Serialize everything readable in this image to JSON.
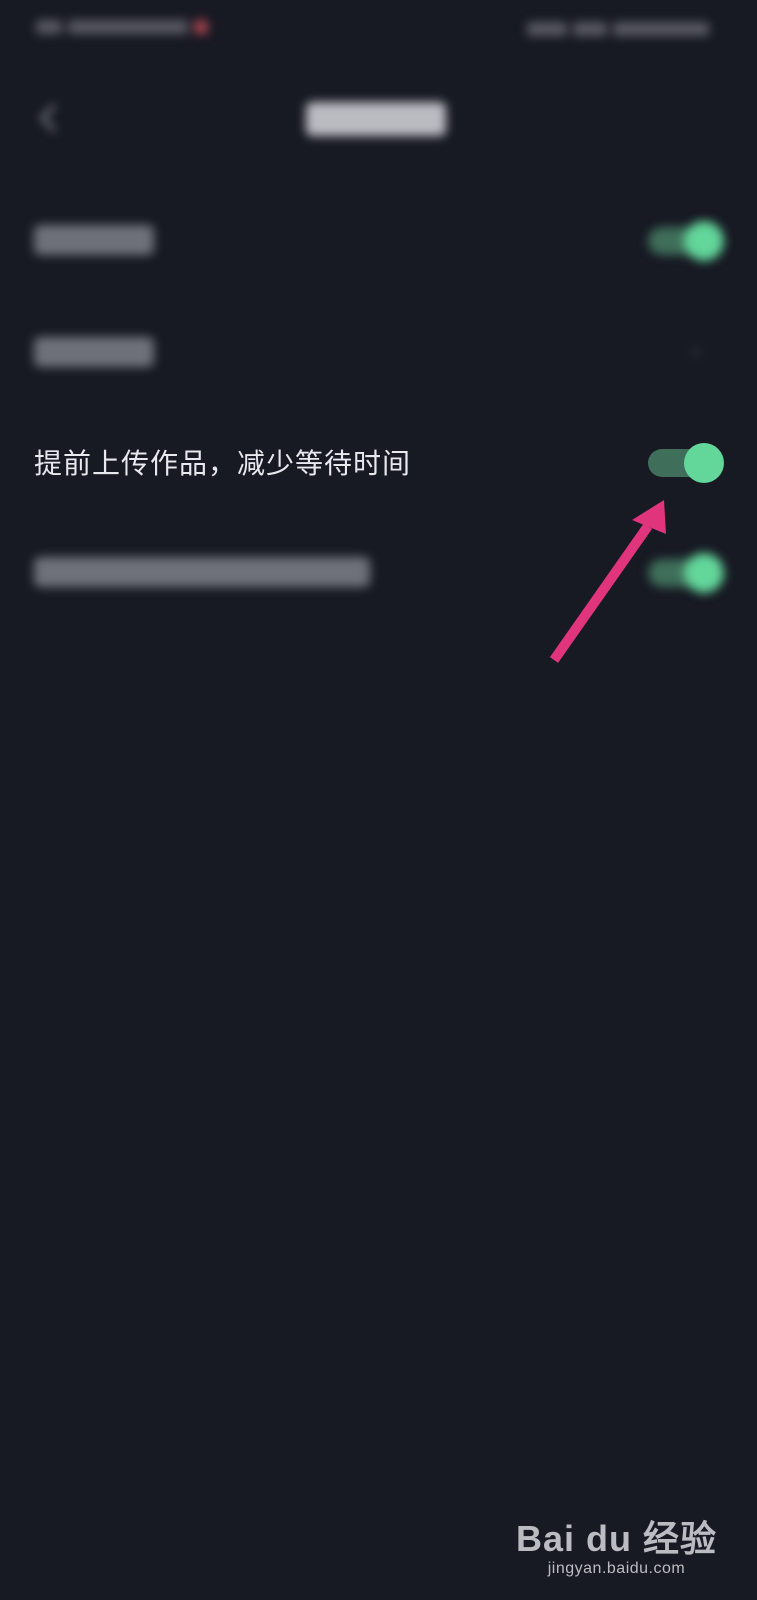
{
  "highlighted_setting": {
    "label": "提前上传作品，减少等待时间",
    "enabled": true
  },
  "colors": {
    "background": "#171923",
    "toggle_on_knob": "#63d69a",
    "toggle_on_track": "#3f6f5a",
    "annotation_arrow": "#e0357d"
  },
  "watermark": {
    "logo_text": "Bai du 经验",
    "subtext": "jingyan.baidu.com"
  }
}
